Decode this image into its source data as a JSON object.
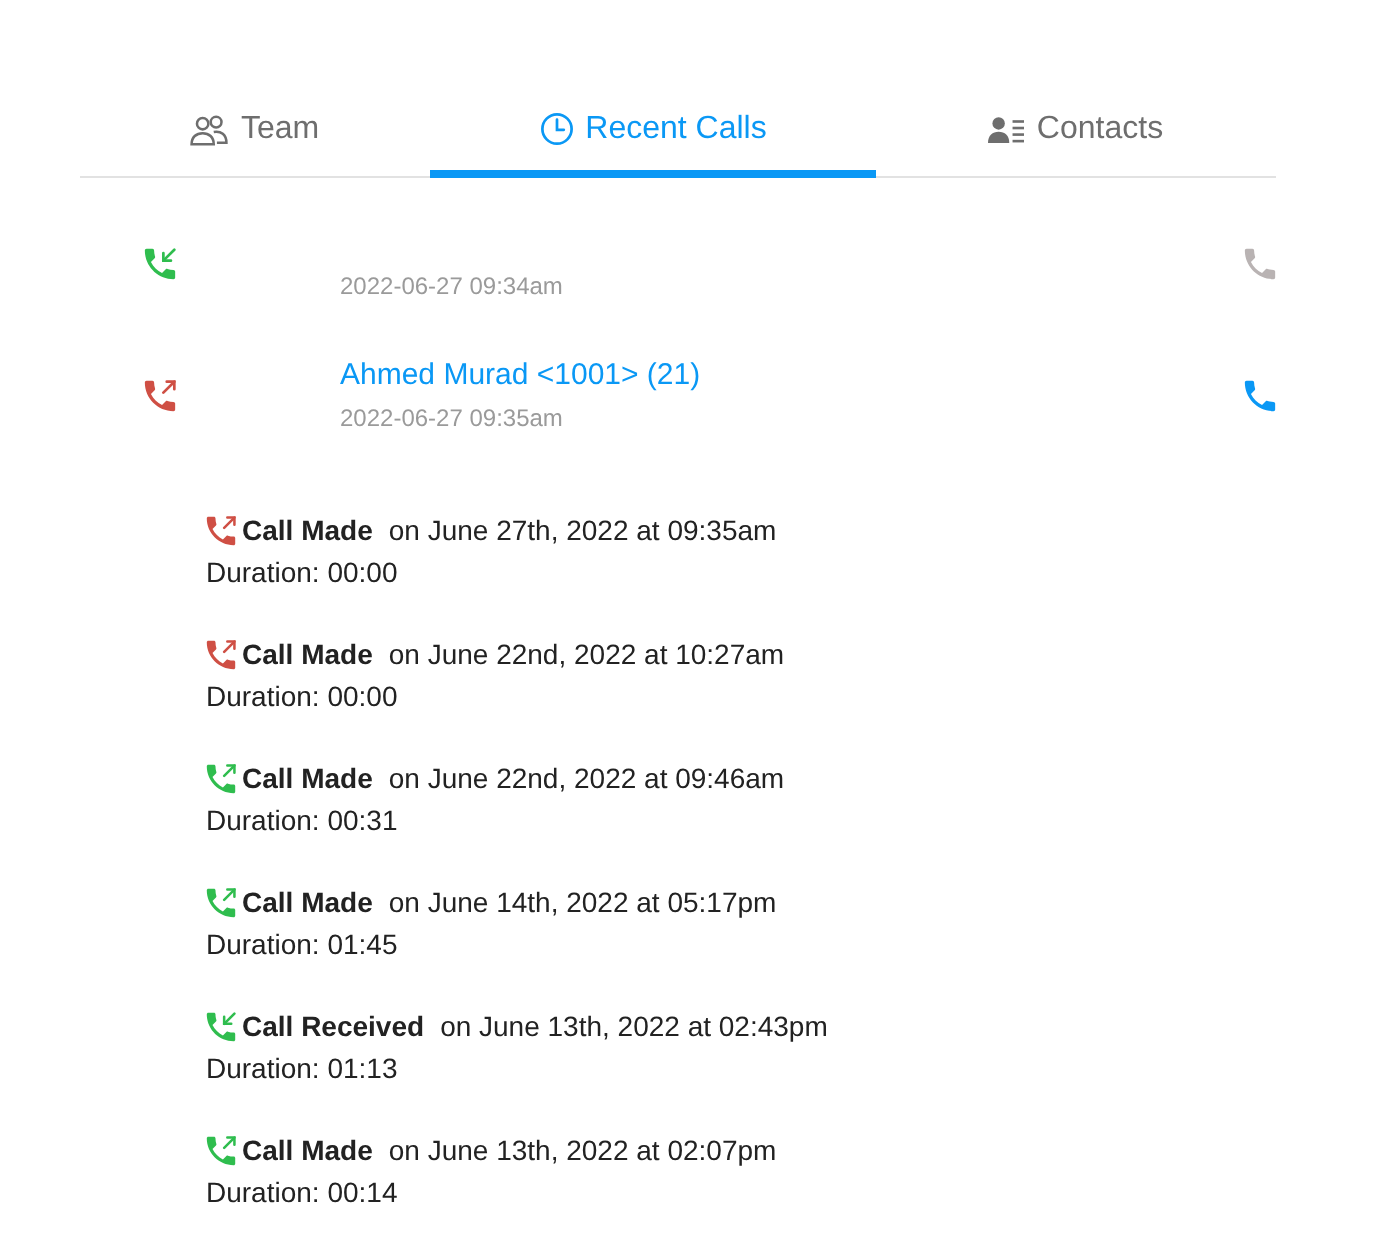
{
  "tabs": [
    {
      "label": "Team",
      "selected": false
    },
    {
      "label": "Recent Calls",
      "selected": true
    },
    {
      "label": "Contacts",
      "selected": false
    }
  ],
  "calls": [
    {
      "kind": "incoming",
      "answered": true,
      "time": "2022-06-27 09:34am",
      "expanded": false
    },
    {
      "kind": "outgoing",
      "answered": false,
      "name": "Ahmed Murad <1001> (21)",
      "time": "2022-06-27 09:35am",
      "expanded": true,
      "history": [
        {
          "kind": "outgoing",
          "answered": false,
          "type": "Call Made",
          "when": "on June 27th, 2022 at 09:35am",
          "duration": "Duration: 00:00"
        },
        {
          "kind": "outgoing",
          "answered": false,
          "type": "Call Made",
          "when": "on June 22nd, 2022 at 10:27am",
          "duration": "Duration: 00:00"
        },
        {
          "kind": "outgoing",
          "answered": true,
          "type": "Call Made",
          "when": "on June 22nd, 2022 at 09:46am",
          "duration": "Duration: 00:31"
        },
        {
          "kind": "outgoing",
          "answered": true,
          "type": "Call Made",
          "when": "on June 14th, 2022 at 05:17pm",
          "duration": "Duration: 01:45"
        },
        {
          "kind": "incoming",
          "answered": true,
          "type": "Call Received",
          "when": "on June 13th, 2022 at 02:43pm",
          "duration": "Duration: 01:13"
        },
        {
          "kind": "outgoing",
          "answered": true,
          "type": "Call Made",
          "when": "on June 13th, 2022 at 02:07pm",
          "duration": "Duration: 00:14"
        }
      ]
    }
  ]
}
